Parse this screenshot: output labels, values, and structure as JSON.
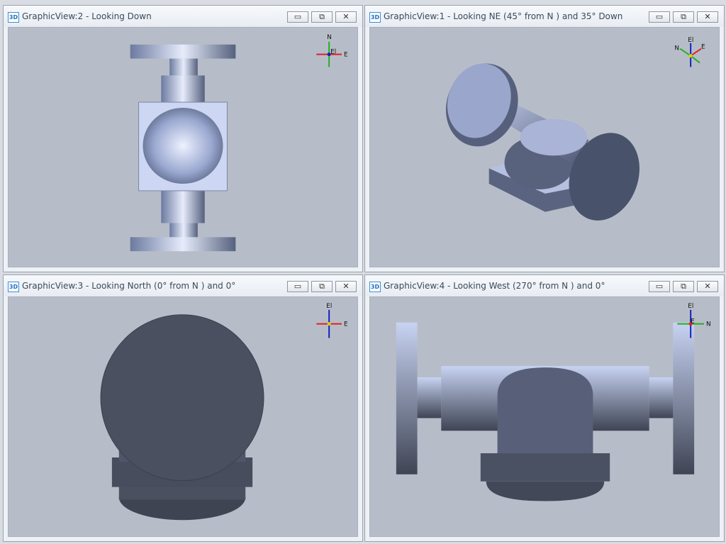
{
  "panes": [
    {
      "badge": "3D",
      "title": "GraphicView:2 - Looking Down",
      "axes": {
        "up": "N",
        "right": "E",
        "center": "El"
      }
    },
    {
      "badge": "3D",
      "title": "GraphicView:1 - Looking NE (45° from N ) and 35° Down",
      "axes": {
        "up": "El",
        "right": "E",
        "left": "N"
      }
    },
    {
      "badge": "3D",
      "title": "GraphicView:3 - Looking North (0° from N ) and 0°",
      "axes": {
        "up": "El",
        "right": "E"
      }
    },
    {
      "badge": "3D",
      "title": "GraphicView:4 - Looking West (270° from N ) and 0°",
      "axes": {
        "up": "El",
        "right": "N",
        "center": "E"
      }
    }
  ],
  "window_buttons": {
    "minimize": "▭",
    "restore": "⧉",
    "close": "✕"
  },
  "colors": {
    "viewport_bg": "#b7bdc8",
    "metal_light": "#c4d0ee",
    "metal_dark": "#444b5a",
    "axis_x": "#e02020",
    "axis_y": "#20b020",
    "axis_z": "#1020c0"
  }
}
